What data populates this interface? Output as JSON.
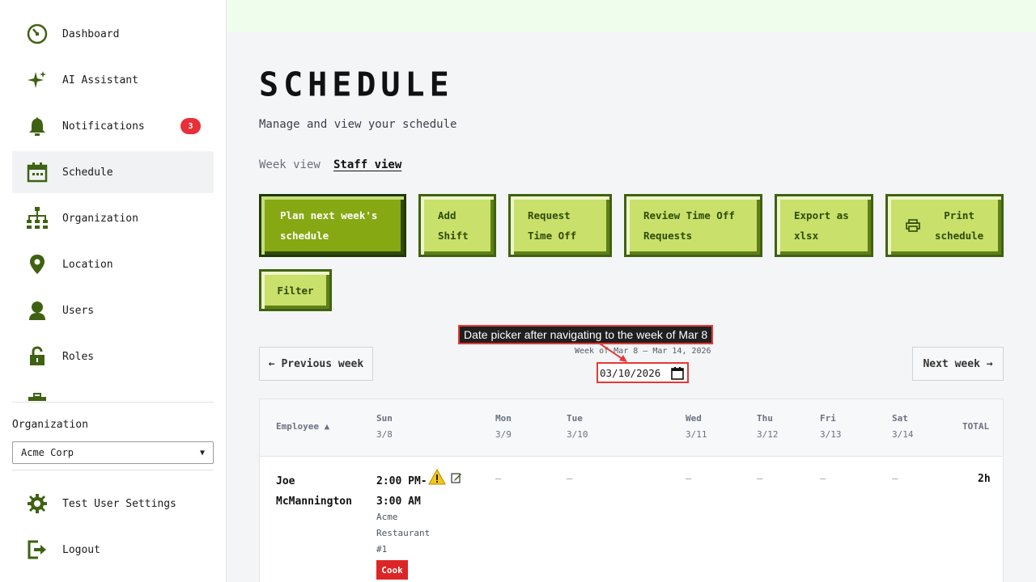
{
  "sidebar": {
    "items": [
      {
        "label": "Dashboard",
        "icon": "dashboard-icon"
      },
      {
        "label": "AI Assistant",
        "icon": "sparkle-icon"
      },
      {
        "label": "Notifications",
        "icon": "bell-icon",
        "badge": "3"
      },
      {
        "label": "Schedule",
        "icon": "calendar-icon",
        "active": true
      },
      {
        "label": "Organization",
        "icon": "org-chart-icon"
      },
      {
        "label": "Location",
        "icon": "location-pin-icon"
      },
      {
        "label": "Users",
        "icon": "user-icon"
      },
      {
        "label": "Roles",
        "icon": "lock-icon"
      }
    ],
    "org_label": "Organization",
    "org_value": "Acme Corp",
    "bottom": [
      {
        "label": "Test User Settings",
        "icon": "gear-icon"
      },
      {
        "label": "Logout",
        "icon": "logout-icon"
      }
    ]
  },
  "page": {
    "title": "SCHEDULE",
    "subtitle": "Manage and view your schedule",
    "tabs": [
      "Week view",
      "Staff view"
    ],
    "active_tab": "Staff view"
  },
  "actions": {
    "plan": "Plan next week's\nschedule",
    "add_shift": "Add\nShift",
    "request_time_off": "Request\nTime Off",
    "review_time_off": "Review Time Off\nRequests",
    "export": "Export as\nxlsx",
    "print": "Print\nschedule",
    "filter": "Filter"
  },
  "week_nav": {
    "prev": "← Previous week",
    "next": "Next week →",
    "range": "Week of Mar 8 – Mar 14, 2026",
    "date_value": "03/10/2026",
    "annotation": "Date picker after navigating to the week of Mar 8"
  },
  "table": {
    "header_employee": "Employee ▲",
    "days": [
      {
        "name": "Sun",
        "date": "3/8"
      },
      {
        "name": "Mon",
        "date": "3/9"
      },
      {
        "name": "Tue",
        "date": "3/10"
      },
      {
        "name": "Wed",
        "date": "3/11"
      },
      {
        "name": "Thu",
        "date": "3/12"
      },
      {
        "name": "Fri",
        "date": "3/13"
      },
      {
        "name": "Sat",
        "date": "3/14"
      }
    ],
    "header_total": "TOTAL",
    "rows": [
      {
        "employee": "Joe\nMcMannington",
        "shift_time": "2:00 PM-\n3:00 AM",
        "shift_location": "Acme\nRestaurant\n#1",
        "shift_role": "Cook",
        "empty_cell": "–",
        "total": "2h"
      }
    ]
  },
  "colors": {
    "accent_green": "#86a813",
    "light_green": "#c9e06a",
    "dark_green": "#3f6212",
    "badge_red": "#e8303a",
    "role_red": "#dc2626",
    "highlight_red": "#e53935"
  }
}
